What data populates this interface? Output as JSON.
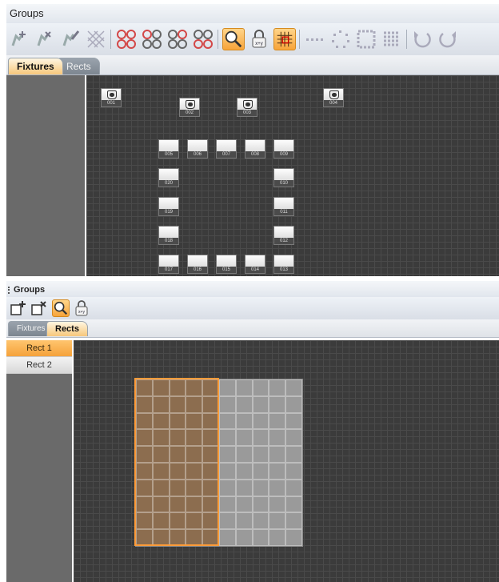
{
  "top_panel": {
    "title": "Groups",
    "tabs": [
      {
        "label": "Fixtures",
        "active": true
      },
      {
        "label": "Rects",
        "active": false
      }
    ],
    "toolbar_icons": [
      "add-fixture-icon",
      "remove-fixture-icon",
      "edit-fixture-icon",
      "hatch-grid-icon",
      "circle-group-1-icon",
      "circle-group-2-icon",
      "circle-group-3-icon",
      "circle-group-4-icon",
      "zoom-icon",
      "lock-xy-icon",
      "snap-grid-icon",
      "line-layout-icon",
      "circle-layout-icon",
      "rect-layout-icon",
      "matrix-layout-icon",
      "undo-icon",
      "redo-icon"
    ],
    "fixtures": [
      {
        "num": "001",
        "icon": true
      },
      {
        "num": "002",
        "icon": true
      },
      {
        "num": "003",
        "icon": true
      },
      {
        "num": "004",
        "icon": true
      },
      {
        "num": "005",
        "icon": false
      },
      {
        "num": "006",
        "icon": false
      },
      {
        "num": "007",
        "icon": false
      },
      {
        "num": "008",
        "icon": false
      },
      {
        "num": "009",
        "icon": false
      },
      {
        "num": "020",
        "icon": false
      },
      {
        "num": "010",
        "icon": false
      },
      {
        "num": "019",
        "icon": false
      },
      {
        "num": "011",
        "icon": false
      },
      {
        "num": "018",
        "icon": false
      },
      {
        "num": "012",
        "icon": false
      },
      {
        "num": "017",
        "icon": false
      },
      {
        "num": "016",
        "icon": false
      },
      {
        "num": "015",
        "icon": false
      },
      {
        "num": "014",
        "icon": false
      },
      {
        "num": "013",
        "icon": false
      }
    ]
  },
  "bottom_panel": {
    "title": "Groups",
    "tabs": [
      {
        "label": "Fixtures",
        "active": false
      },
      {
        "label": "Rects",
        "active": true
      }
    ],
    "toolbar_icons": [
      "add-rect-icon",
      "remove-rect-icon",
      "zoom-icon",
      "lock-xy-icon"
    ],
    "rects": [
      {
        "label": "Rect 1",
        "active": true
      },
      {
        "label": "Rect 2",
        "active": false
      }
    ],
    "grid": {
      "columns": 10,
      "rows": 10,
      "selected_columns": 5
    },
    "colors": {
      "accent": "#f5a23a",
      "selection_border": "#ff9c3a",
      "canvas": "#3b3b3b"
    }
  }
}
